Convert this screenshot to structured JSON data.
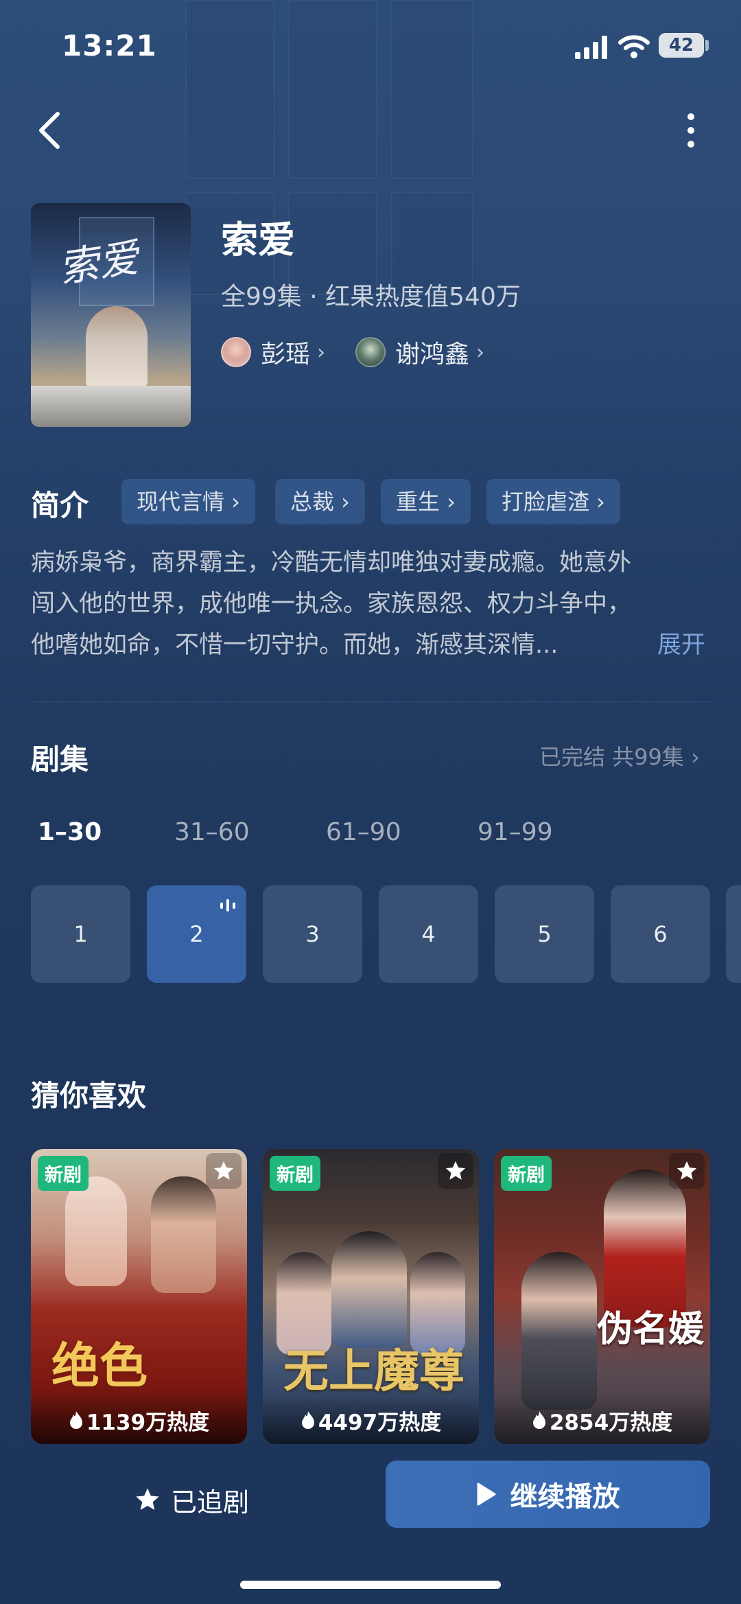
{
  "status_bar": {
    "time": "13:21",
    "battery": "42"
  },
  "drama": {
    "title": "索爱",
    "meta": "全99集 · 红果热度值540万",
    "actors": [
      {
        "name": "彭瑶"
      },
      {
        "name": "谢鸿鑫"
      }
    ]
  },
  "intro": {
    "label": "简介",
    "tags": [
      "现代言情 ›",
      "总裁 ›",
      "重生 ›",
      "打脸虐渣 ›"
    ],
    "lines": [
      "病娇枭爷，商界霸主，冷酷无情却唯独对妻成瘾。她意外",
      "闯入他的世界，成他唯一执念。家族恩怨、权力斗争中，",
      "他嗜她如命，不惜一切守护。而她，渐感其深情..."
    ],
    "expand_label": "展开"
  },
  "episodes": {
    "label": "剧集",
    "status": "已完结 共99集 ›",
    "ranges": [
      "1–30",
      "31–60",
      "61–90",
      "91–99"
    ],
    "active_range": 0,
    "items": [
      "1",
      "2",
      "3",
      "4",
      "5",
      "6"
    ],
    "active_episode": 1
  },
  "recommend": {
    "label": "猜你喜欢",
    "cards": [
      {
        "badge": "新剧",
        "heat": "1139万热度"
      },
      {
        "badge": "新剧",
        "heat": "4497万热度"
      },
      {
        "badge": "新剧",
        "heat": "2854万热度"
      }
    ]
  },
  "bottom": {
    "follow_label": "已追剧",
    "play_label": "继续播放"
  },
  "colors": {
    "accent": "#3763a6",
    "badge": "#1fb77b",
    "link": "#7da4dd"
  }
}
